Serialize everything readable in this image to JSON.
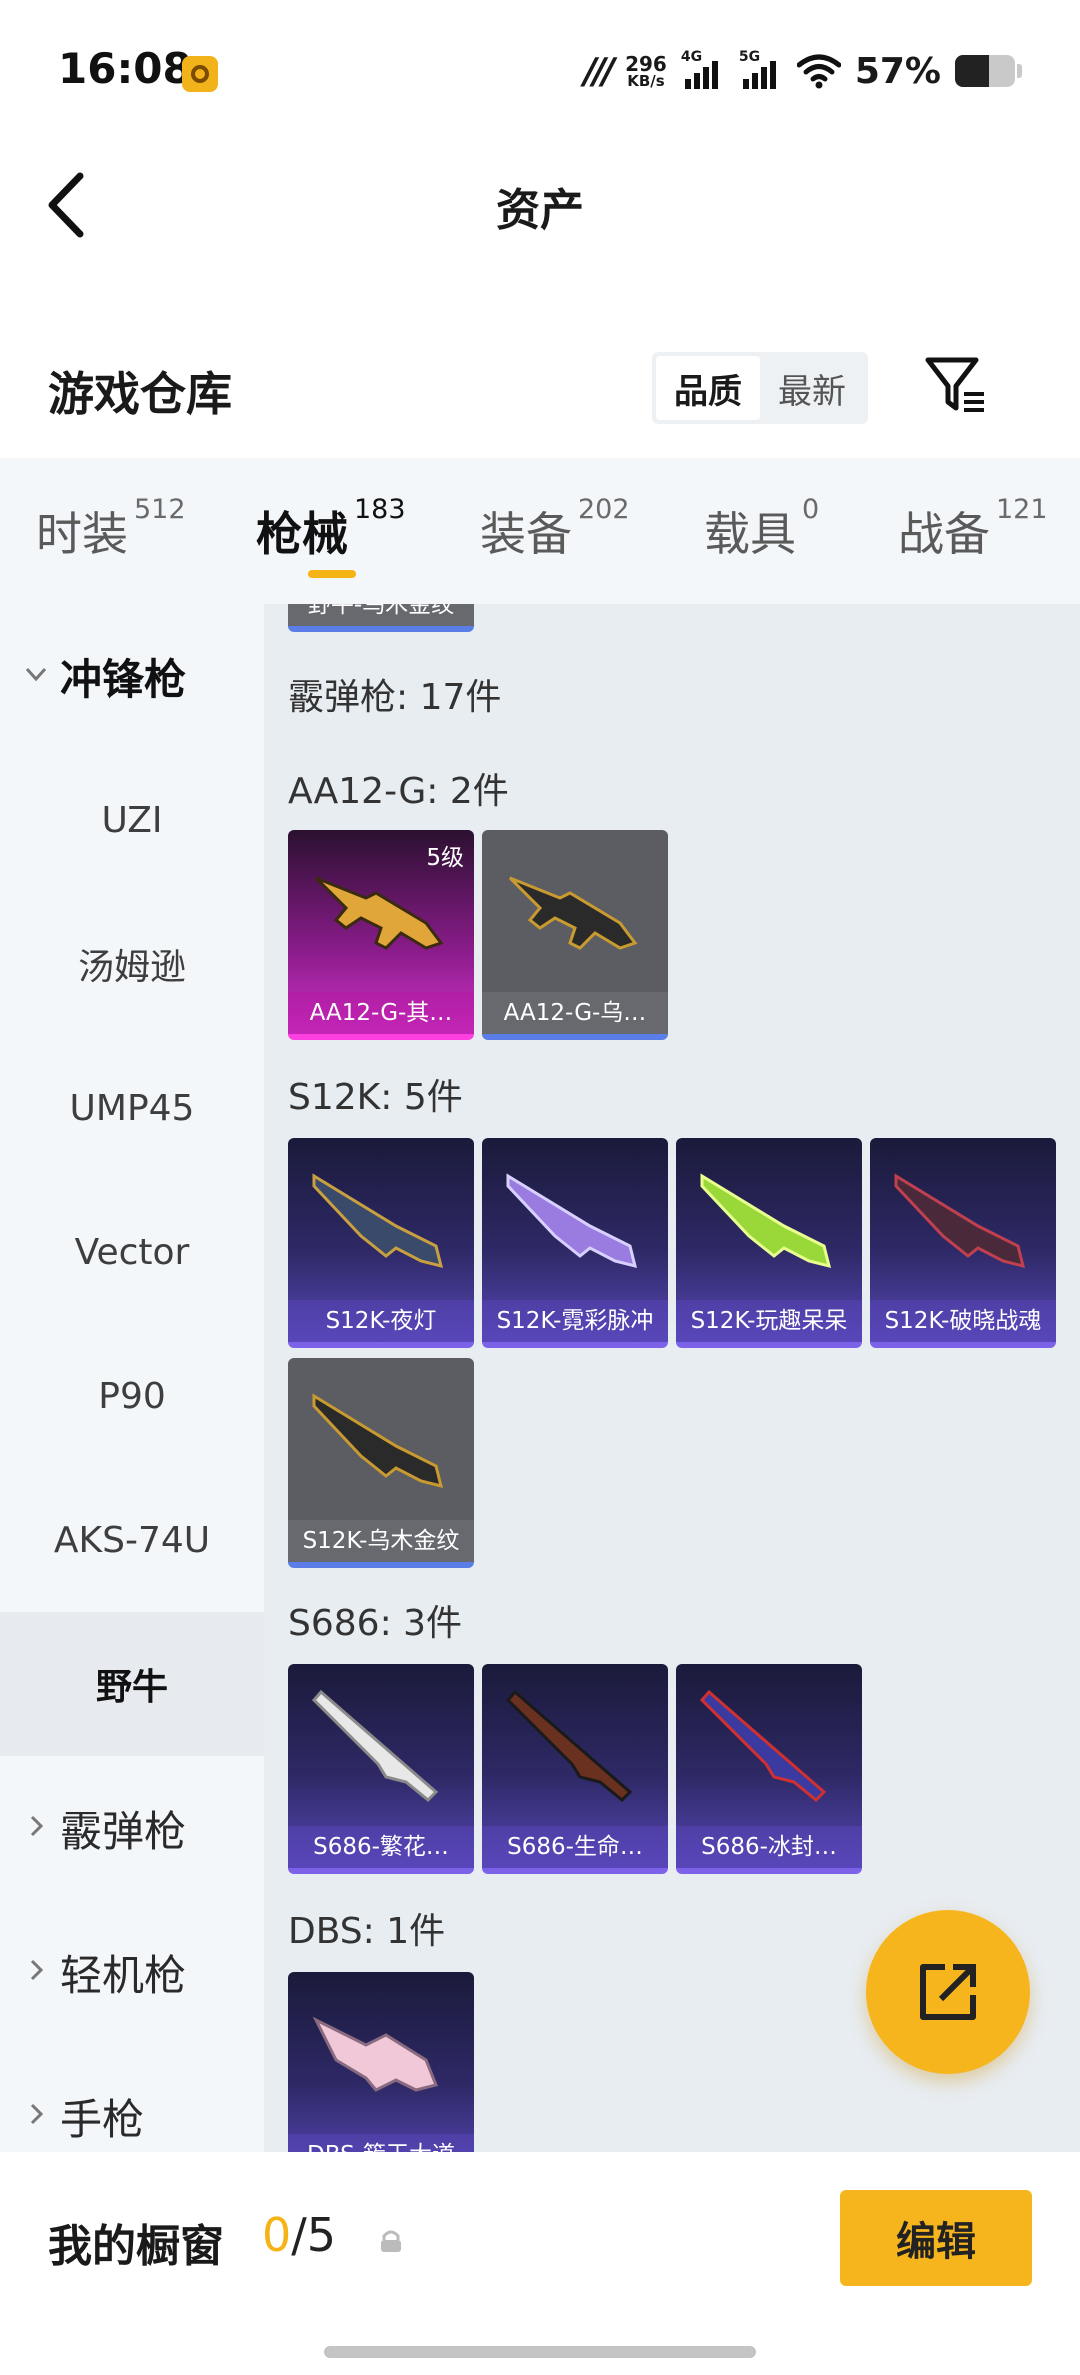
{
  "status_bar": {
    "time": "16:08",
    "net_speed_value": "296",
    "net_speed_unit": "KB/s",
    "signal1_label": "4G",
    "signal2_label": "5G",
    "battery_text": "57%",
    "battery_level": 0.57
  },
  "header": {
    "title": "资产"
  },
  "warehouse": {
    "title": "游戏仓库",
    "sort_options": [
      "品质",
      "最新"
    ],
    "sort_selected": "品质"
  },
  "tabs": [
    {
      "name": "时装",
      "count": "512"
    },
    {
      "name": "枪械",
      "count": "183"
    },
    {
      "name": "装备",
      "count": "202"
    },
    {
      "name": "载具",
      "count": "0"
    },
    {
      "name": "战备",
      "count": "121"
    }
  ],
  "active_tab": "枪械",
  "sidebar": {
    "expanded_category": "冲锋枪",
    "sub_items": [
      "UZI",
      "汤姆逊",
      "UMP45",
      "Vector",
      "P90",
      "AKS-74U",
      "野牛"
    ],
    "selected_item": "野牛",
    "collapsed_categories": [
      "霰弹枪",
      "轻机枪",
      "手枪"
    ]
  },
  "content": {
    "previous_card_label": "野牛-乌木金纹",
    "category_title": "霰弹枪: 17件",
    "groups": [
      {
        "title": "AA12-G: 2件",
        "items": [
          {
            "label": "AA12-G-其…",
            "quality": "pink",
            "badge": "5级"
          },
          {
            "label": "AA12-G-乌…",
            "quality": "grey"
          }
        ]
      },
      {
        "title": "S12K: 5件",
        "items": [
          {
            "label": "S12K-夜灯",
            "quality": "purple"
          },
          {
            "label": "S12K-霓彩脉冲",
            "quality": "purple"
          },
          {
            "label": "S12K-玩趣呆呆",
            "quality": "purple"
          },
          {
            "label": "S12K-破晓战魂",
            "quality": "purple"
          },
          {
            "label": "S12K-乌木金纹",
            "quality": "grey"
          }
        ]
      },
      {
        "title": "S686: 3件",
        "items": [
          {
            "label": "S686-繁花…",
            "quality": "purple"
          },
          {
            "label": "S686-生命…",
            "quality": "purple"
          },
          {
            "label": "S686-冰封…",
            "quality": "purple"
          }
        ]
      },
      {
        "title": "DBS: 1件",
        "items": [
          {
            "label": "DBS-簇王大道",
            "quality": "purple"
          }
        ]
      }
    ]
  },
  "showcase": {
    "label": "我的橱窗",
    "current": "0",
    "separator": "/",
    "max": "5",
    "edit_label": "编辑"
  },
  "colors": {
    "accent": "#f7b51d",
    "tab_indicator": "#f5b316",
    "purple_quality": "#5747b6",
    "pink_quality": "#d234c8",
    "grey_quality": "#5b5d62"
  },
  "icons": [
    "back-arrow-icon",
    "filter-icon",
    "share-icon",
    "lock-icon",
    "chevron-down-icon",
    "chevron-right-icon",
    "wifi-icon",
    "signal-icon",
    "battery-icon",
    "app-icon"
  ]
}
